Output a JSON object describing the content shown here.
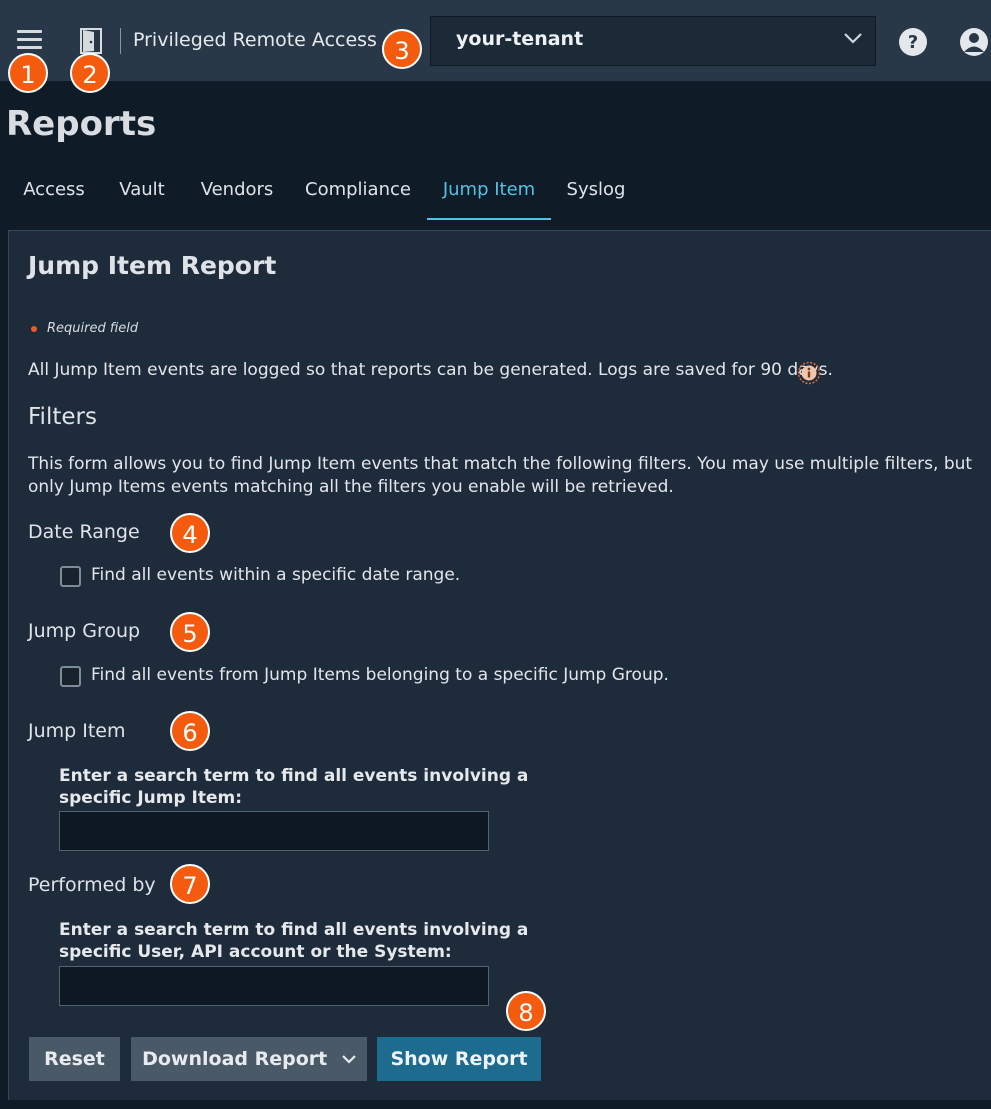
{
  "header": {
    "app_title": "Privileged Remote Access",
    "tenant": "your-tenant"
  },
  "badges": [
    "1",
    "2",
    "3",
    "4",
    "5",
    "6",
    "7",
    "8"
  ],
  "page": {
    "title": "Reports"
  },
  "tabs": [
    {
      "label": "Access"
    },
    {
      "label": "Vault"
    },
    {
      "label": "Vendors"
    },
    {
      "label": "Compliance"
    },
    {
      "label": "Jump Item"
    },
    {
      "label": "Syslog"
    }
  ],
  "active_tab": "Jump Item",
  "report": {
    "title": "Jump Item Report",
    "required_note": "Required field",
    "info": "All Jump Item events are logged so that reports can be generated. Logs are saved for 90 days.",
    "filters_heading": "Filters",
    "filters_desc": "This form allows you to find Jump Item events that match the following filters. You may use multiple filters, but only Jump Items events matching all the filters you enable will be retrieved.",
    "date_range": {
      "label": "Date Range",
      "checkbox_label": "Find all events within a specific date range.",
      "checked": false
    },
    "jump_group": {
      "label": "Jump Group",
      "checkbox_label": "Find all events from Jump Items belonging to a specific Jump Group.",
      "checked": false
    },
    "jump_item": {
      "label": "Jump Item",
      "field_label": "Enter a search term to find all events involving a specific Jump Item:",
      "value": ""
    },
    "performed_by": {
      "label": "Performed by",
      "field_label": "Enter a search term to find all events involving a specific User, API account or the System:",
      "value": ""
    },
    "buttons": {
      "reset": "Reset",
      "download": "Download Report",
      "show": "Show Report"
    }
  },
  "colors": {
    "badge": "#f45b0e",
    "accent": "#54c1e3",
    "primary_button": "#1d6b8e",
    "header_bg": "#283848",
    "panel_bg": "#1e2b3b"
  },
  "icons": [
    "hamburger-menu-icon",
    "door-icon",
    "chevron-down-icon",
    "help-icon",
    "user-account-icon",
    "info-icon"
  ]
}
